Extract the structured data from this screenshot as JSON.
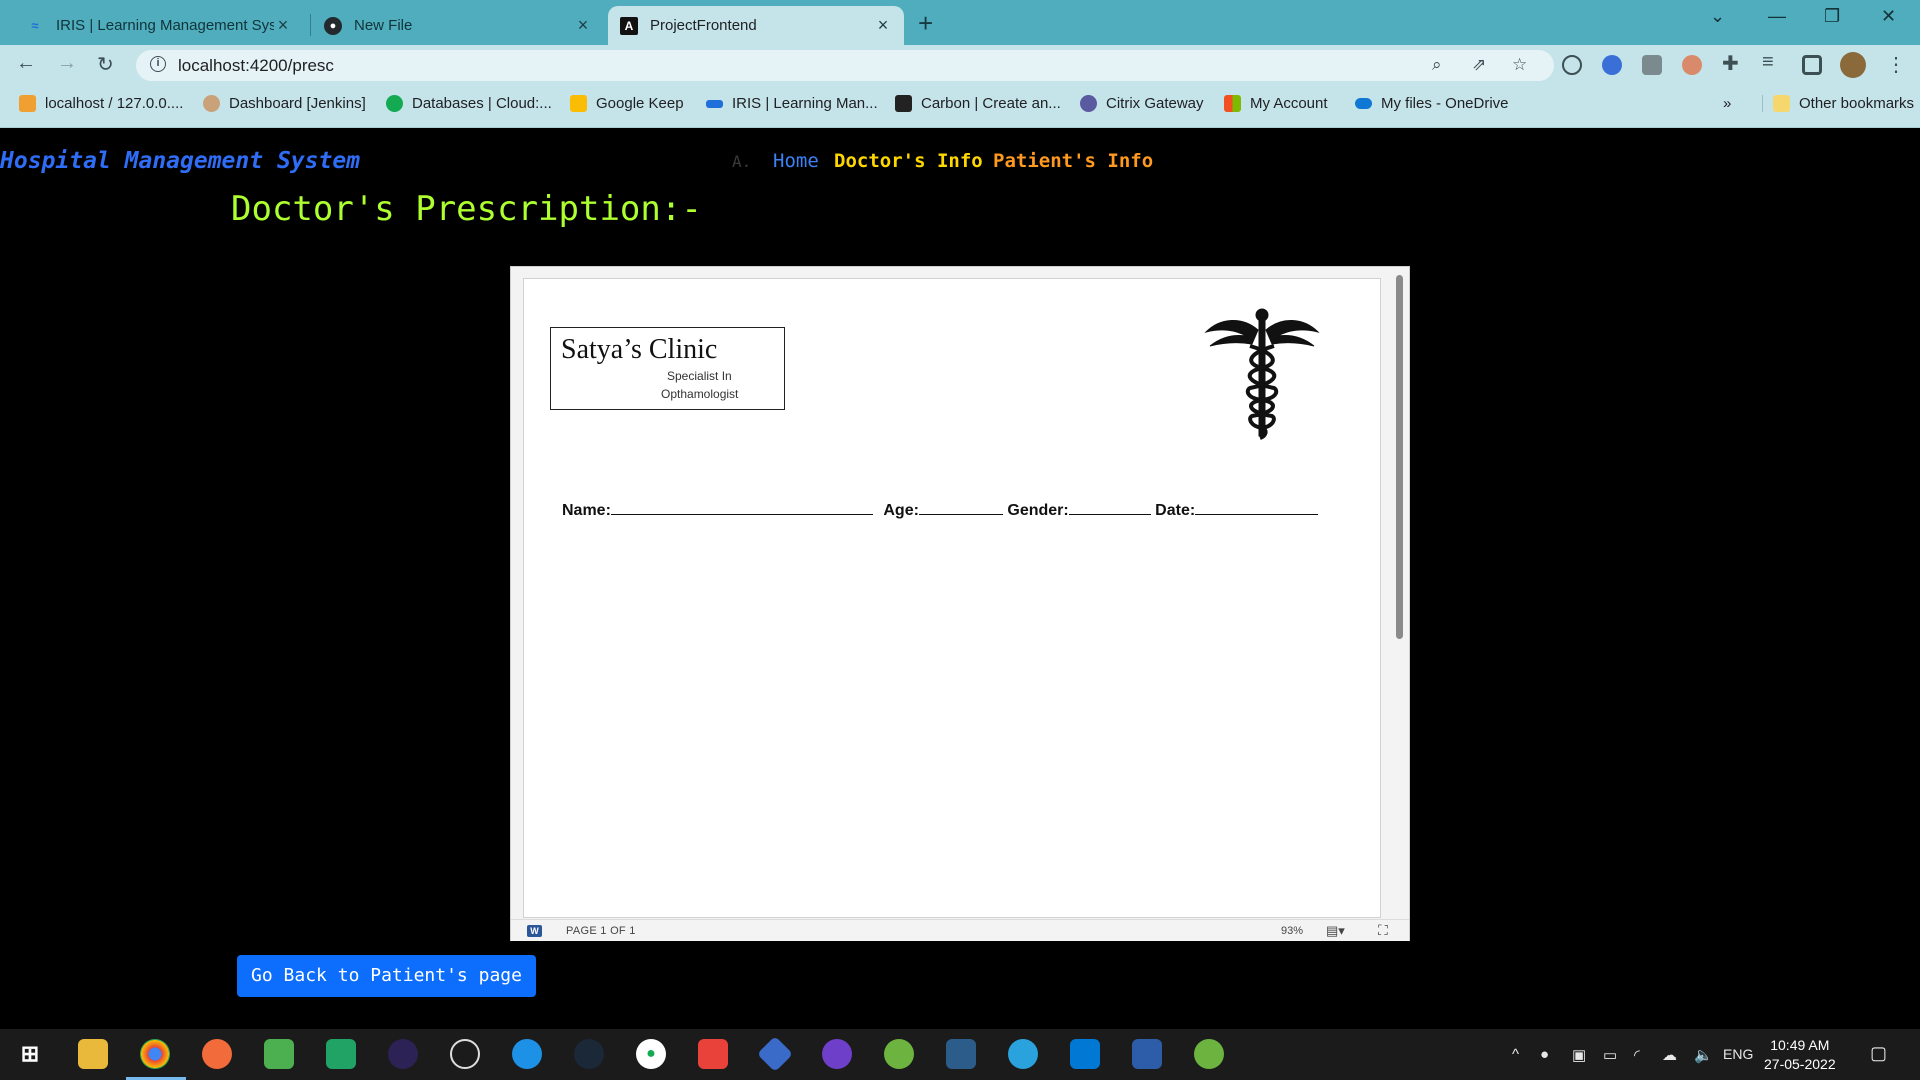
{
  "browser": {
    "tabs": [
      {
        "title": "IRIS | Learning Management Syst",
        "icon": "iris-icon"
      },
      {
        "title": "New File",
        "icon": "github-icon"
      },
      {
        "title": "ProjectFrontend",
        "icon": "angular-icon"
      }
    ],
    "url": "localhost:4200/presc",
    "bookmarks": [
      {
        "label": "localhost / 127.0.0....",
        "icon": "phpmyadmin-icon",
        "color": "#f0a030"
      },
      {
        "label": "Dashboard [Jenkins]",
        "icon": "jenkins-icon",
        "color": "#c9a27a"
      },
      {
        "label": "Databases | Cloud:...",
        "icon": "mongodb-icon",
        "color": "#13aa52"
      },
      {
        "label": "Google Keep",
        "icon": "keep-icon",
        "color": "#fbbc04"
      },
      {
        "label": "IRIS | Learning Man...",
        "icon": "iris-icon",
        "color": "#1e6fd9"
      },
      {
        "label": "Carbon | Create an...",
        "icon": "carbon-icon",
        "color": "#222222"
      },
      {
        "label": "Citrix Gateway",
        "icon": "citrix-icon",
        "color": "#5a5aa0"
      },
      {
        "label": "My Account",
        "icon": "microsoft-icon",
        "color": "#f25022"
      },
      {
        "label": "My files - OneDrive",
        "icon": "onedrive-icon",
        "color": "#0f78d4"
      }
    ],
    "other_bookmarks": "Other bookmarks",
    "overflow": "»"
  },
  "app": {
    "brand": "Hospital Management System",
    "nav": {
      "a": "A.",
      "home": "Home",
      "doctor": "Doctor's Info",
      "patient": "Patient's Info"
    },
    "heading": "Doctor's Prescription:-",
    "back_button": "Go Back to Patient's page"
  },
  "document": {
    "clinic_name": "Satya’s Clinic",
    "specialist_line1": "Specialist In",
    "specialist_line2": "Opthamologist",
    "fields": {
      "name": "Name:",
      "age": "Age:",
      "gender": "Gender:",
      "date": "Date:"
    },
    "page_count": "PAGE 1 OF 1",
    "zoom": "93%"
  },
  "taskbar": {
    "language": "ENG",
    "time": "10:49 AM",
    "date": "27-05-2022"
  }
}
